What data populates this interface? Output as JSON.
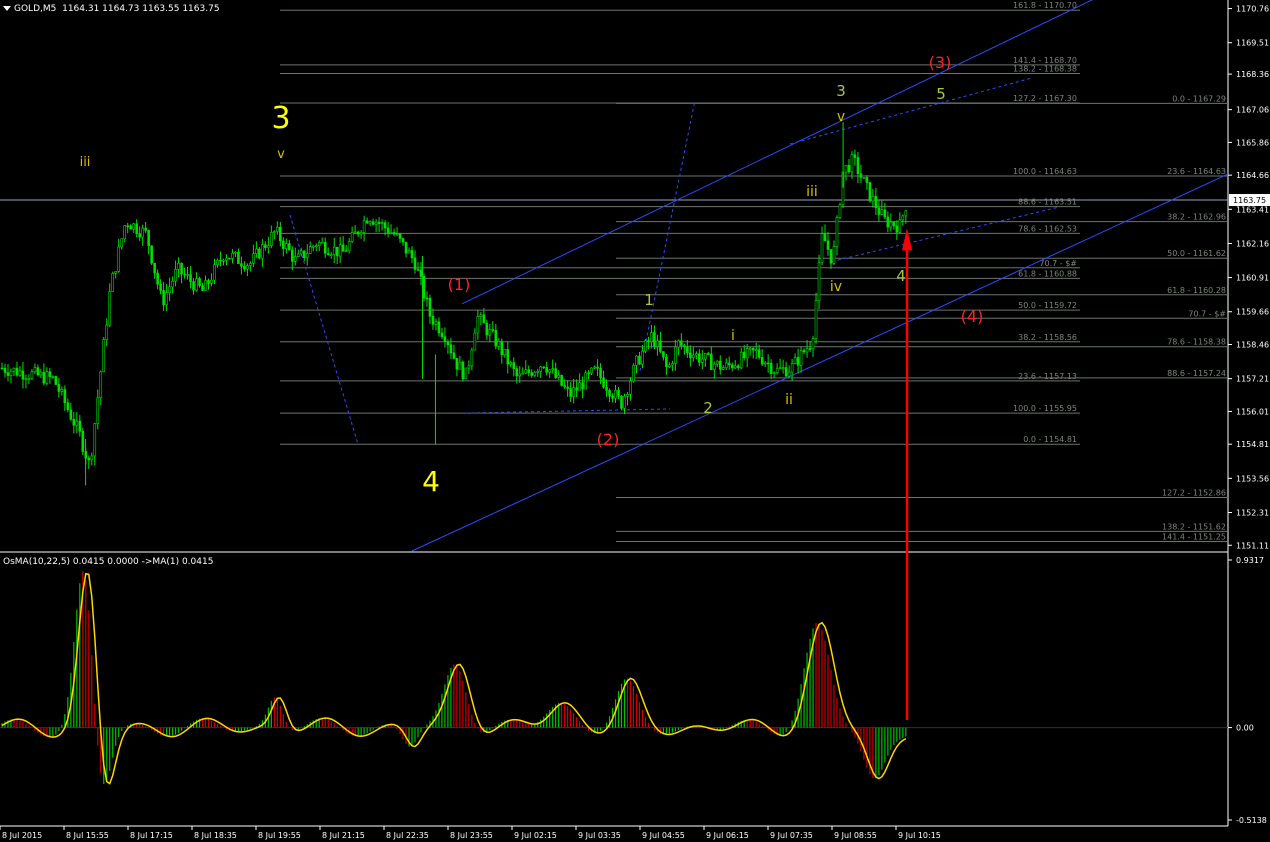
{
  "header": {
    "symbol": "GOLD,M5",
    "ohlc": "1164.31 1164.73 1163.55 1163.75",
    "indicator": "OsMA(10,22,5) 0.0415 0.0000 ->MA(1) 0.0415"
  },
  "colors": {
    "background": "#000000",
    "candle": "#00e000",
    "axis": "#ffffff",
    "fib": "#6c746c",
    "channel": "#2b4bff",
    "arrow": "#ff0000",
    "osma_up": "#00c000",
    "osma_down": "#d00000",
    "osma_signal": "#ffd700"
  },
  "chart_data": [
    {
      "type": "candlestick",
      "symbol": "GOLD",
      "timeframe": "M5",
      "ylim": [
        1150.9,
        1171.0
      ],
      "y_ticks": [
        "1170.76",
        "1169.51",
        "1168.36",
        "1167.06",
        "1165.86",
        "1164.66",
        "1163.41",
        "1162.16",
        "1160.91",
        "1159.66",
        "1158.46",
        "1157.21",
        "1156.01",
        "1154.81",
        "1153.56",
        "1152.31",
        "1151.11"
      ],
      "current_price": "1163.75",
      "x_ticks": [
        "8 Jul 2015",
        "8 Jul 15:55",
        "8 Jul 17:15",
        "8 Jul 18:35",
        "8 Jul 19:55",
        "8 Jul 21:15",
        "8 Jul 22:35",
        "8 Jul 23:55",
        "9 Jul 02:15",
        "9 Jul 03:35",
        "9 Jul 04:55",
        "9 Jul 06:15",
        "9 Jul 07:35",
        "9 Jul 08:55",
        "9 Jul 10:15"
      ],
      "price_path": [
        {
          "t": 0.0,
          "p": 1157.6
        },
        {
          "t": 1.0,
          "p": 1157.2
        },
        {
          "t": 1.5,
          "p": 1155.2
        },
        {
          "t": 1.7,
          "p": 1154.0
        },
        {
          "t": 2.1,
          "p": 1160.5
        },
        {
          "t": 2.4,
          "p": 1163.0
        },
        {
          "t": 2.8,
          "p": 1162.5
        },
        {
          "t": 3.1,
          "p": 1160.0
        },
        {
          "t": 3.4,
          "p": 1161.2
        },
        {
          "t": 3.9,
          "p": 1160.4
        },
        {
          "t": 4.3,
          "p": 1161.8
        },
        {
          "t": 4.8,
          "p": 1161.4
        },
        {
          "t": 5.3,
          "p": 1162.6
        },
        {
          "t": 5.7,
          "p": 1161.5
        },
        {
          "t": 6.1,
          "p": 1162.2
        },
        {
          "t": 6.6,
          "p": 1161.8
        },
        {
          "t": 7.1,
          "p": 1163.2
        },
        {
          "t": 7.6,
          "p": 1162.5
        },
        {
          "t": 8.0,
          "p": 1161.5
        },
        {
          "t": 8.3,
          "p": 1159.5
        },
        {
          "t": 8.6,
          "p": 1158.8
        },
        {
          "t": 8.8,
          "p": 1157.8
        },
        {
          "t": 9.0,
          "p": 1157.3
        },
        {
          "t": 9.2,
          "p": 1159.5
        },
        {
          "t": 9.6,
          "p": 1158.5
        },
        {
          "t": 10.0,
          "p": 1157.2
        },
        {
          "t": 10.5,
          "p": 1157.8
        },
        {
          "t": 11.0,
          "p": 1156.6
        },
        {
          "t": 11.5,
          "p": 1157.5
        },
        {
          "t": 12.0,
          "p": 1156.3
        },
        {
          "t": 12.3,
          "p": 1157.8
        },
        {
          "t": 12.6,
          "p": 1158.8
        },
        {
          "t": 12.9,
          "p": 1157.5
        },
        {
          "t": 13.1,
          "p": 1158.5
        },
        {
          "t": 13.5,
          "p": 1158.0
        },
        {
          "t": 14.0,
          "p": 1157.6
        },
        {
          "t": 14.6,
          "p": 1158.2
        },
        {
          "t": 15.0,
          "p": 1157.5
        },
        {
          "t": 15.3,
          "p": 1157.6
        },
        {
          "t": 15.7,
          "p": 1158.6
        },
        {
          "t": 15.9,
          "p": 1162.5
        },
        {
          "t": 16.1,
          "p": 1161.5
        },
        {
          "t": 16.3,
          "p": 1164.8
        },
        {
          "t": 16.5,
          "p": 1165.2
        },
        {
          "t": 16.8,
          "p": 1164.0
        },
        {
          "t": 17.1,
          "p": 1163.0
        },
        {
          "t": 17.4,
          "p": 1162.8
        },
        {
          "t": 17.55,
          "p": 1163.8
        }
      ],
      "fib_levels_upper_right": [
        "161.8 - 1170.70",
        "141.4 - 1168.70",
        "138.2 - 1168.38",
        "127.2 - 1167.30",
        "100.0 - 1164.63",
        "88.6 - 1163.51",
        "78.6 - 1162.53",
        "70.7 - $#",
        "61.8 - 1160.88",
        "50.0 - 1159.72",
        "38.2 - 1158.56",
        "23.6 - 1157.13",
        "100.0 - 1155.95",
        "0.0 - 1154.81"
      ],
      "fib_levels_right": [
        "0.0 - 1167.29",
        "23.6 - 1164.63",
        "38.2 - 1162.96",
        "50.0 - 1161.62",
        "61.8 - 1160.28",
        "70.7 - $#",
        "78.6 - 1158.38",
        "88.6 - 1157.24"
      ],
      "fib_levels_lower": [
        "127.2 - 1152.86",
        "138.2 - 1151.62",
        "141.4 - 1151.25"
      ],
      "wave_labels": [
        {
          "text": "iii",
          "color": "#d4c200"
        },
        {
          "text": "3",
          "color": "#ffff00"
        },
        {
          "text": "v",
          "color": "#d4c200"
        },
        {
          "text": "4",
          "color": "#ffff00"
        },
        {
          "text": "(1)",
          "color": "#ff2020"
        },
        {
          "text": "(2)",
          "color": "#ff2020"
        },
        {
          "text": "1",
          "color": "#a8c840"
        },
        {
          "text": "2",
          "color": "#a8c840"
        },
        {
          "text": "i",
          "color": "#d4c200"
        },
        {
          "text": "ii",
          "color": "#d4c200"
        },
        {
          "text": "iii",
          "color": "#d4c200"
        },
        {
          "text": "iv",
          "color": "#d4c200"
        },
        {
          "text": "3",
          "color": "#a8c840"
        },
        {
          "text": "v",
          "color": "#d4c200"
        },
        {
          "text": "4",
          "color": "#a8c840"
        },
        {
          "text": "5",
          "color": "#a8c840"
        },
        {
          "text": "(3)",
          "color": "#ff2020"
        },
        {
          "text": "(4)",
          "color": "#ff2020"
        }
      ]
    },
    {
      "type": "bar",
      "name": "OsMA(10,22,5)",
      "ylim": [
        -0.5138,
        0.9317
      ],
      "y_ticks": [
        "0.9317",
        "0.00",
        "-0.5138"
      ],
      "current_value": 0.0415
    }
  ]
}
